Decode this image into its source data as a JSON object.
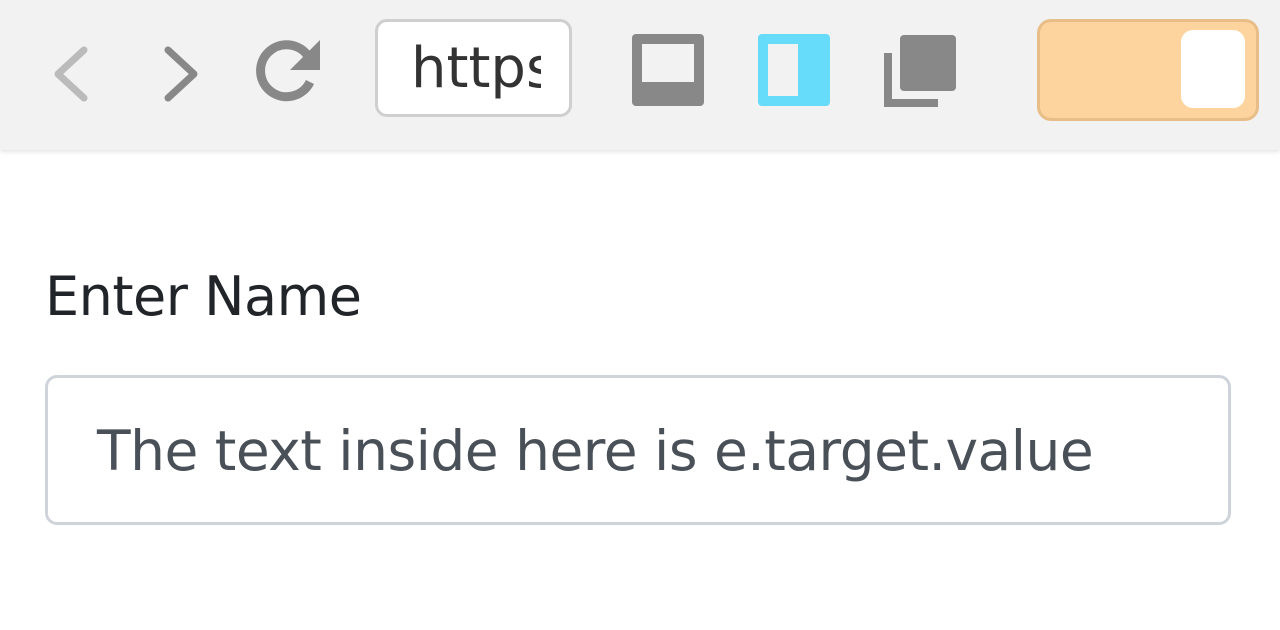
{
  "toolbar": {
    "url": "https://",
    "toggle_on": true,
    "icons": [
      "back-icon",
      "forward-icon",
      "reload-icon",
      "dock-bottom-icon",
      "dock-side-icon",
      "undock-icon"
    ],
    "colors": {
      "background": "#f2f2f2",
      "icon": "#888888",
      "icon_disabled": "#bbbbbb",
      "dock_side_active": "#66dbfa",
      "toggle_fill": "#fdd49e",
      "toggle_border": "#e8be88"
    }
  },
  "form": {
    "label": "Enter Name",
    "input_value": "The text inside here is e.target.value"
  }
}
